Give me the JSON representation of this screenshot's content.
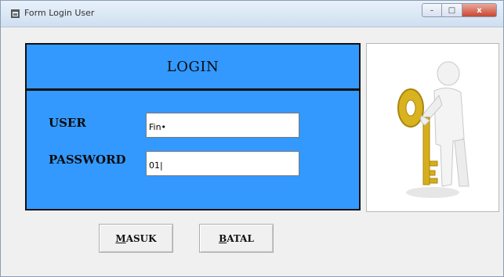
{
  "window": {
    "title": "Form Login User",
    "controls": {
      "minimize": "–",
      "maximize": "□",
      "close": "x"
    }
  },
  "login": {
    "header": "LOGIN",
    "user_label": "USER",
    "user_value": "Fin•",
    "password_label": "PASSWORD",
    "password_value": "01|"
  },
  "picture": {
    "icon": "person-with-key-icon"
  },
  "buttons": {
    "masuk": {
      "underline": "M",
      "rest": "ASUK"
    },
    "batal": {
      "underline": "B",
      "rest": "ATAL"
    }
  },
  "colors": {
    "panel_blue": "#3399ff",
    "key_gold": "#d9b21f"
  }
}
